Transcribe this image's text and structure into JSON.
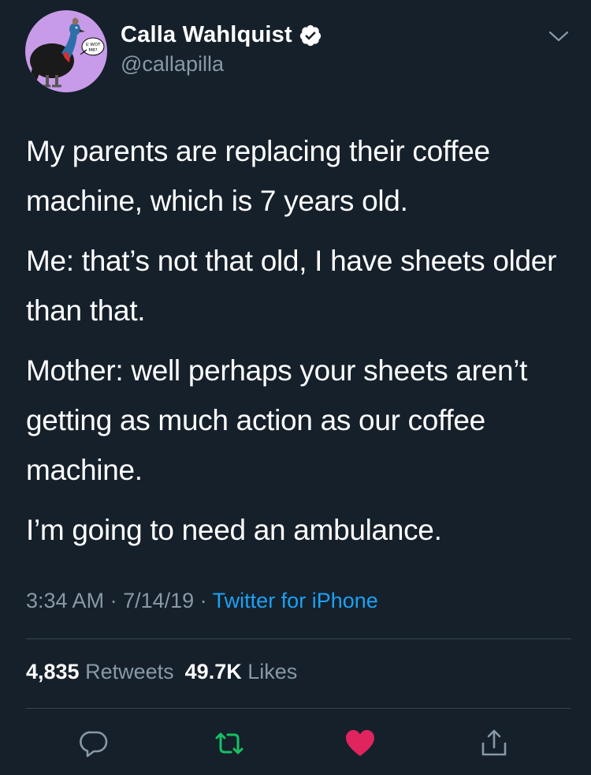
{
  "author": {
    "display_name": "Calla Wahlquist",
    "handle": "@callapilla",
    "verified": true,
    "avatar_text": "U WOT M8?"
  },
  "tweet": {
    "paragraphs": [
      "My parents are replacing their coffee machine, which is 7 years old.",
      "Me: that’s not that old, I have sheets older than that.",
      "Mother: well perhaps your sheets aren’t getting as much action as our coffee machine.",
      "I’m going to need an ambulance."
    ]
  },
  "meta": {
    "time": "3:34 AM",
    "separator": " · ",
    "date": "7/14/19",
    "source": "Twitter for iPhone"
  },
  "stats": {
    "retweets_count": "4,835",
    "retweets_label": "Retweets",
    "likes_count": "49.7K",
    "likes_label": "Likes"
  },
  "actions": {
    "reply_icon": "reply-icon",
    "retweet_icon": "retweet-icon",
    "like_icon": "heart-icon",
    "share_icon": "share-icon"
  },
  "colors": {
    "background": "#15202b",
    "primary_text": "#ffffff",
    "secondary_text": "#8899a6",
    "link": "#1da1f2",
    "retweet_green": "#17bf63",
    "like_red": "#e0245e",
    "divider": "#38444d",
    "avatar_bg": "#c89be8"
  }
}
